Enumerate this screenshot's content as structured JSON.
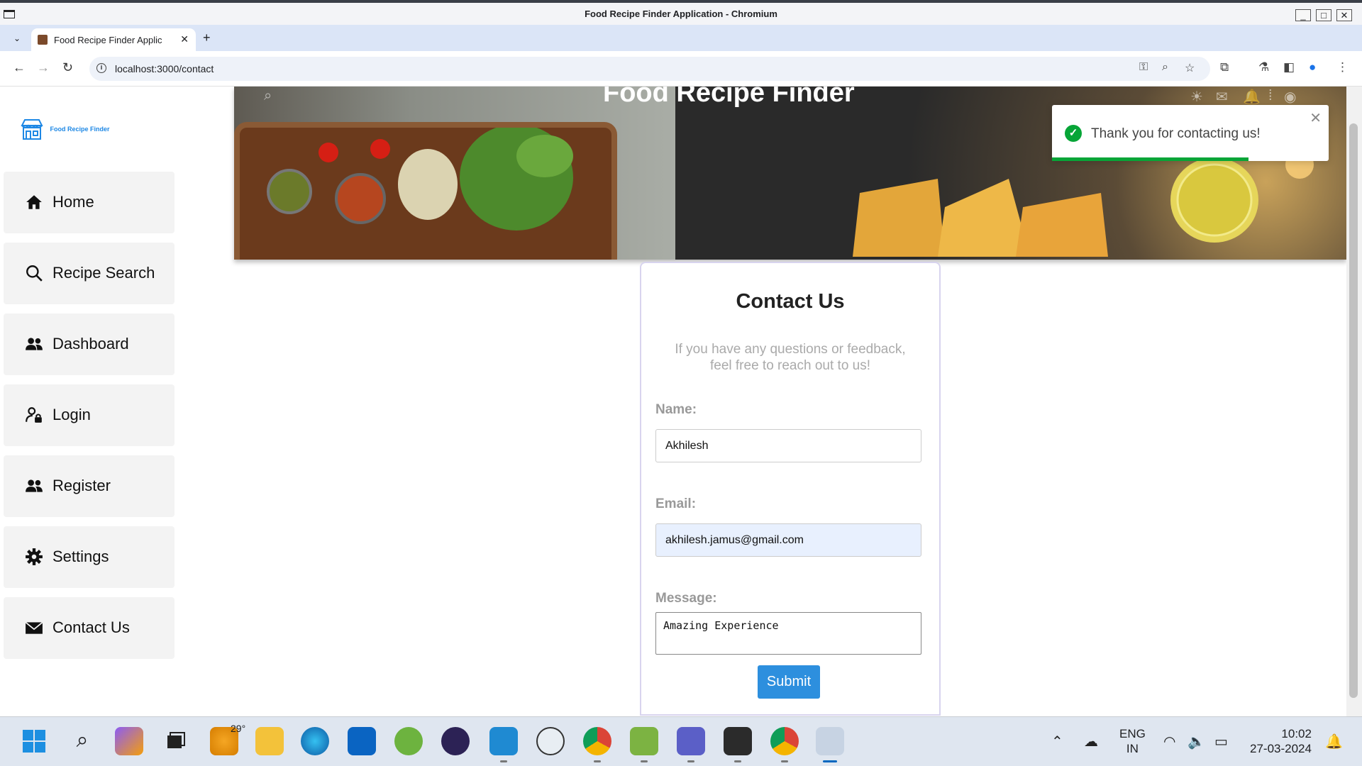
{
  "window": {
    "title": "Food Recipe Finder Application - Chromium"
  },
  "browser": {
    "tab_title": "Food Recipe Finder Applic",
    "url": "localhost:3000/contact"
  },
  "app": {
    "logo_text": "Food Recipe Finder",
    "banner_title": "Food Recipe Finder",
    "menu": [
      {
        "label": "Home",
        "icon": "home-icon"
      },
      {
        "label": "Recipe Search",
        "icon": "search-icon"
      },
      {
        "label": "Dashboard",
        "icon": "users-icon"
      },
      {
        "label": "Login",
        "icon": "user-lock-icon"
      },
      {
        "label": "Register",
        "icon": "users-icon"
      },
      {
        "label": "Settings",
        "icon": "gear-icon"
      },
      {
        "label": "Contact Us",
        "icon": "envelope-icon"
      }
    ]
  },
  "toast": {
    "message": "Thank you for contacting us!",
    "progress": 0.71,
    "color": "#07a537"
  },
  "contact": {
    "heading": "Contact Us",
    "intro": "If you have any questions or feedback, feel free to reach out to us!",
    "name_label": "Name:",
    "name_value": "Akhilesh",
    "email_label": "Email:",
    "email_value": "akhilesh.jamus@gmail.com",
    "message_label": "Message:",
    "message_value": "Amazing Experience",
    "submit_label": "Submit",
    "accent": "#2d8fde"
  },
  "taskbar": {
    "weather_temp": "29°",
    "language": "ENG",
    "region": "IN",
    "time": "10:02",
    "date": "27-03-2024"
  }
}
